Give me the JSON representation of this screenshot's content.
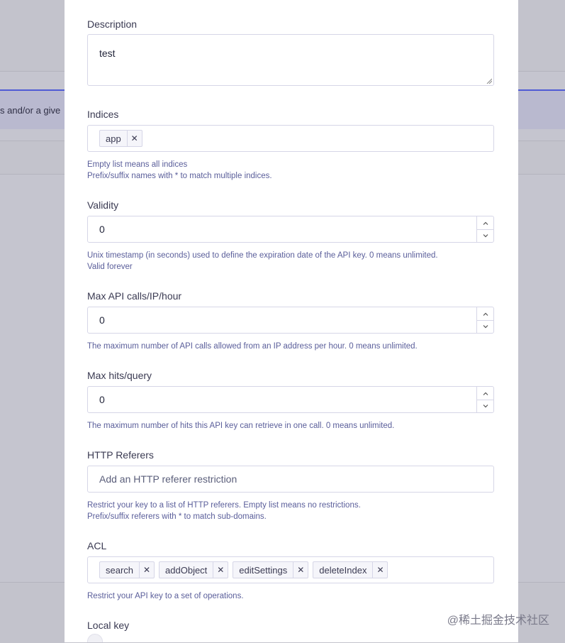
{
  "background": {
    "banner_text": "s and/or a give"
  },
  "form": {
    "description": {
      "label": "Description",
      "value": "test"
    },
    "indices": {
      "label": "Indices",
      "tags": [
        "app"
      ],
      "help1": "Empty list means all indices",
      "help2": "Prefix/suffix names with * to match multiple indices."
    },
    "validity": {
      "label": "Validity",
      "value": "0",
      "help1": "Unix timestamp (in seconds) used to define the expiration date of the API key. 0 means unlimited.",
      "help2": "Valid forever"
    },
    "max_api_calls": {
      "label": "Max API calls/IP/hour",
      "value": "0",
      "help": "The maximum number of API calls allowed from an IP address per hour. 0 means unlimited."
    },
    "max_hits": {
      "label": "Max hits/query",
      "value": "0",
      "help": "The maximum number of hits this API key can retrieve in one call. 0 means unlimited."
    },
    "http_referers": {
      "label": "HTTP Referers",
      "placeholder": "Add an HTTP referer restriction",
      "help1": "Restrict your key to a list of HTTP referers. Empty list means no restrictions.",
      "help2": "Prefix/suffix referers with * to match sub-domains."
    },
    "acl": {
      "label": "ACL",
      "tags": [
        "search",
        "addObject",
        "editSettings",
        "deleteIndex"
      ],
      "help": "Restrict your API key to a set of operations."
    },
    "local_key": {
      "label": "Local key"
    },
    "remove_glyph": "✕"
  },
  "watermark": "@稀土掘金技术社区",
  "colors": {
    "accent": "#4f5bd5",
    "help_text": "#5a5e9a",
    "border": "#d6d6e7"
  }
}
